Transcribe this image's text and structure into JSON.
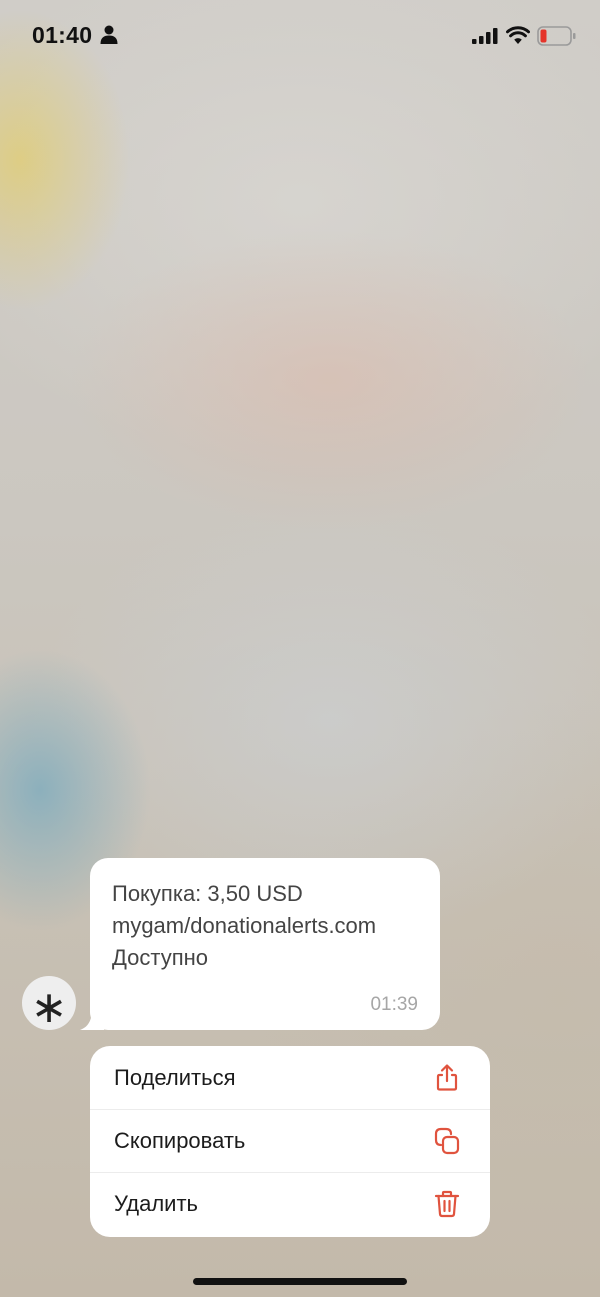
{
  "status_bar": {
    "time": "01:40",
    "icons": [
      "person-icon",
      "cellular-signal-icon",
      "wifi-icon",
      "battery-low-icon"
    ],
    "battery_color": "#e5342a"
  },
  "message": {
    "avatar_symbol": "∗",
    "lines": [
      "Покупка: 3,50 USD",
      "mygam/donationalerts.com",
      "Доступно"
    ],
    "time": "01:39"
  },
  "context_menu": {
    "accent_color": "#e0533e",
    "items": [
      {
        "label": "Поделиться",
        "icon": "share-icon"
      },
      {
        "label": "Скопировать",
        "icon": "copy-icon"
      },
      {
        "label": "Удалить",
        "icon": "trash-icon"
      }
    ]
  }
}
